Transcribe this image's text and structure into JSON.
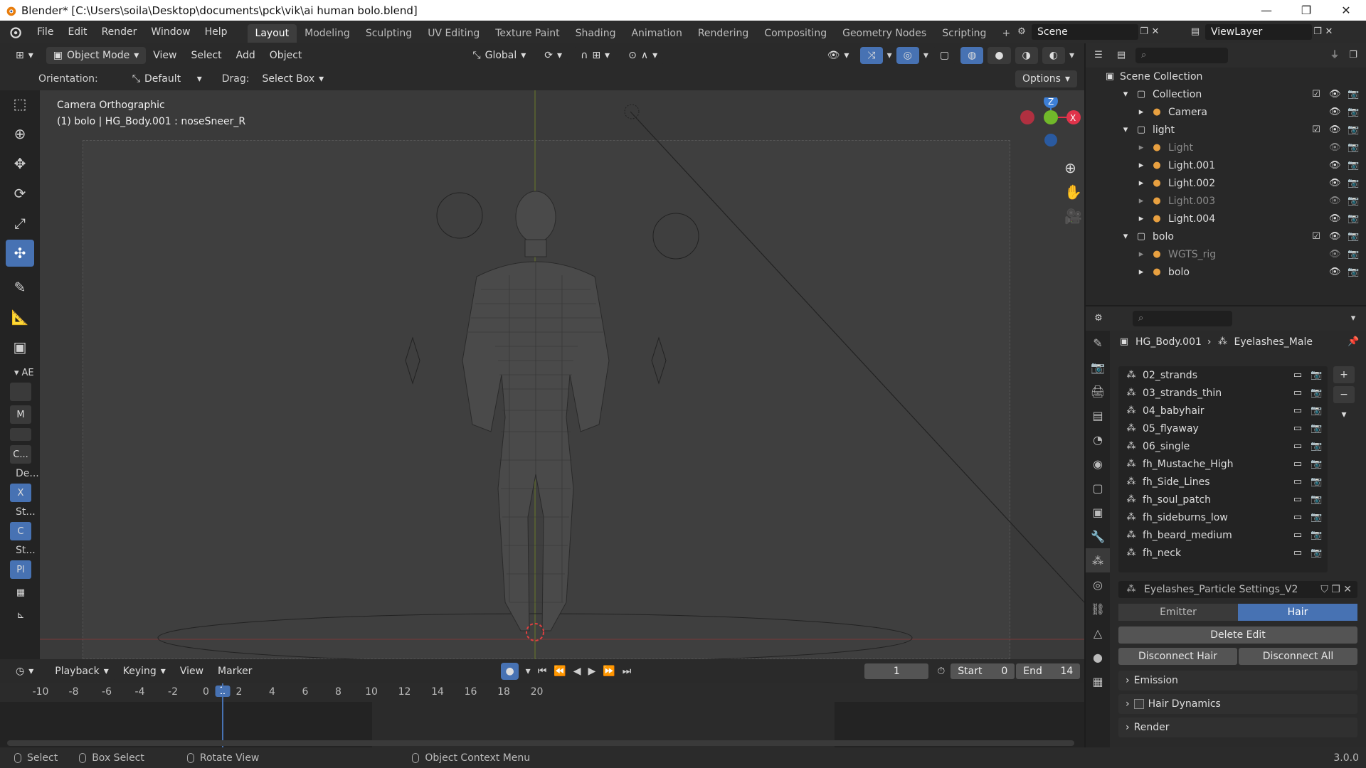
{
  "window": {
    "title": "Blender* [C:\\Users\\soila\\Desktop\\documents\\pck\\vik\\ai human bolo.blend]",
    "controls": [
      "—",
      "❐",
      "✕"
    ]
  },
  "menu": [
    "File",
    "Edit",
    "Render",
    "Window",
    "Help"
  ],
  "workspaces": [
    "Layout",
    "Modeling",
    "Sculpting",
    "UV Editing",
    "Texture Paint",
    "Shading",
    "Animation",
    "Rendering",
    "Compositing",
    "Geometry Nodes",
    "Scripting"
  ],
  "active_workspace": "Layout",
  "scene": "Scene",
  "view_layer": "ViewLayer",
  "viewport_header": {
    "mode": "Object Mode",
    "menus": [
      "View",
      "Select",
      "Add",
      "Object"
    ],
    "transform": "Global",
    "orientation_label": "Orientation:",
    "orientation": "Default",
    "drag_label": "Drag:",
    "drag": "Select Box",
    "options": "Options"
  },
  "viewport": {
    "camera_label": "Camera Orthographic",
    "object_label": "(1) bolo | HG_Body.001 : noseSneer_R"
  },
  "toolbar_labels": {
    "section": "AE",
    "m": "M",
    "c": "C...",
    "de": "De...",
    "x": "X",
    "st1": "St...",
    "c2": "C",
    "st2": "St...",
    "pl": "Pl"
  },
  "outliner": {
    "root": "Scene Collection",
    "rows": [
      {
        "name": "Collection",
        "indent": 1,
        "dim": false
      },
      {
        "name": "Camera",
        "indent": 2,
        "dim": false
      },
      {
        "name": "light",
        "indent": 1,
        "dim": false
      },
      {
        "name": "Light",
        "indent": 2,
        "dim": true
      },
      {
        "name": "Light.001",
        "indent": 2,
        "dim": false
      },
      {
        "name": "Light.002",
        "indent": 2,
        "dim": false
      },
      {
        "name": "Light.003",
        "indent": 2,
        "dim": true
      },
      {
        "name": "Light.004",
        "indent": 2,
        "dim": false
      },
      {
        "name": "bolo",
        "indent": 1,
        "dim": false
      },
      {
        "name": "WGTS_rig",
        "indent": 2,
        "dim": true
      },
      {
        "name": "bolo",
        "indent": 2,
        "dim": false
      }
    ]
  },
  "properties": {
    "object": "HG_Body.001",
    "particle_system": "Eyelashes_Male",
    "particle_list": [
      "02_strands",
      "03_strands_thin",
      "04_babyhair",
      "05_flyaway",
      "06_single",
      "fh_Mustache_High",
      "fh_Side_Lines",
      "fh_soul_patch",
      "fh_sideburns_low",
      "fh_beard_medium",
      "fh_neck"
    ],
    "settings_name": "Eyelashes_Particle Settings_V2",
    "type_emitter": "Emitter",
    "type_hair": "Hair",
    "delete_edit": "Delete Edit",
    "disconnect_hair": "Disconnect Hair",
    "disconnect_all": "Disconnect All",
    "panels": [
      "Emission",
      "Hair Dynamics",
      "Render"
    ]
  },
  "timeline": {
    "menus": [
      "Playback",
      "Keying",
      "View",
      "Marker"
    ],
    "current_frame": "1",
    "start_label": "Start",
    "start": "0",
    "end_label": "End",
    "end": "14",
    "ticks": [
      "-10",
      "-8",
      "-6",
      "-4",
      "-2",
      "0",
      "2",
      "4",
      "6",
      "8",
      "10",
      "12",
      "14",
      "16",
      "18",
      "20"
    ],
    "playhead": "1"
  },
  "statusbar": {
    "select": "Select",
    "box_select": "Box Select",
    "rotate_view": "Rotate View",
    "context_menu": "Object Context Menu",
    "version": "3.0.0"
  },
  "colors": {
    "accent": "#4772b3",
    "axis_x": "#e0334a",
    "axis_y": "#71b82a",
    "axis_z": "#3d7fd6"
  }
}
